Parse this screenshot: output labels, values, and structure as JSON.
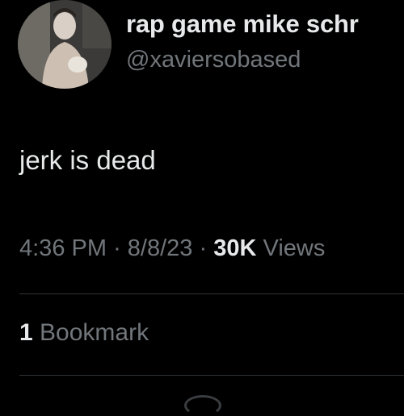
{
  "author": {
    "display_name": "rap game mike schr",
    "handle": "@xaviersobased"
  },
  "tweet": {
    "text": "jerk is dead",
    "time": "4:36 PM",
    "separator": "·",
    "date": "8/8/23",
    "views_count": "30K",
    "views_label": "Views"
  },
  "engagement": {
    "bookmark_count": "1",
    "bookmark_label": "Bookmark"
  },
  "colors": {
    "background": "#000000",
    "primary_text": "#e7e9ea",
    "secondary_text": "#71767b",
    "divider": "#2f3336"
  }
}
